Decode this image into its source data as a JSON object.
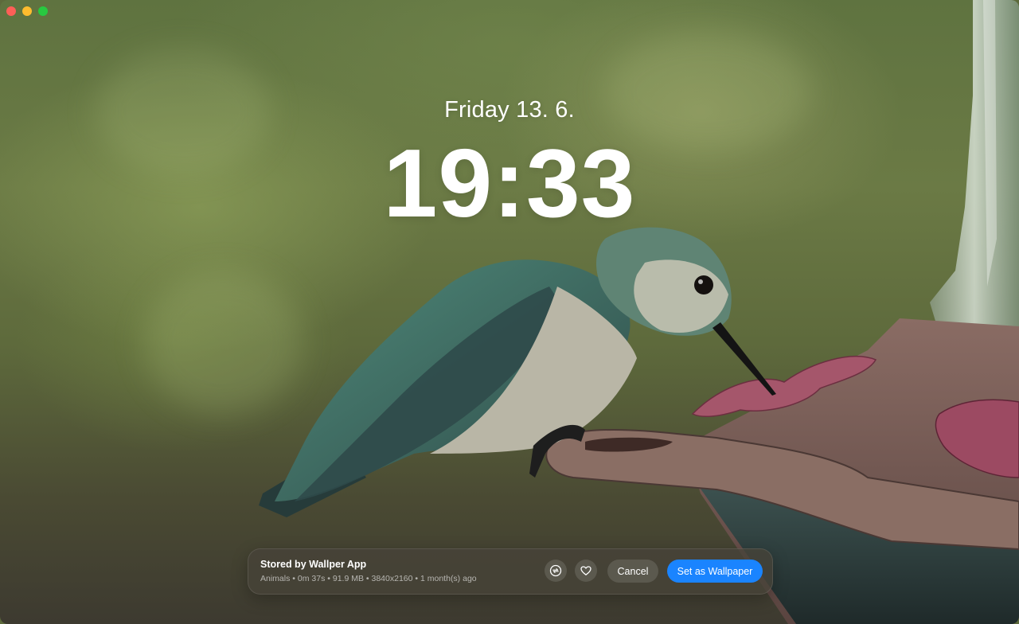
{
  "lockscreen": {
    "date": "Friday 13. 6.",
    "time": "19:33"
  },
  "wallpaper": {
    "subject": "Hummingbird at feeder"
  },
  "bottom_bar": {
    "title": "Stored by Wallper App",
    "category": "Animals",
    "duration": "0m 37s",
    "size": "91.9 MB",
    "resolution": "3840x2160",
    "age": "1 month(s) ago",
    "separator": "•",
    "shuffle_icon": "shuffle-icon",
    "favorite_icon": "heart-icon",
    "cancel_label": "Cancel",
    "set_label": "Set as Wallpaper"
  },
  "colors": {
    "primary_button": "#1a84ff",
    "close": "#fe5f57",
    "minimize": "#febc2e",
    "maximize": "#28c840"
  }
}
